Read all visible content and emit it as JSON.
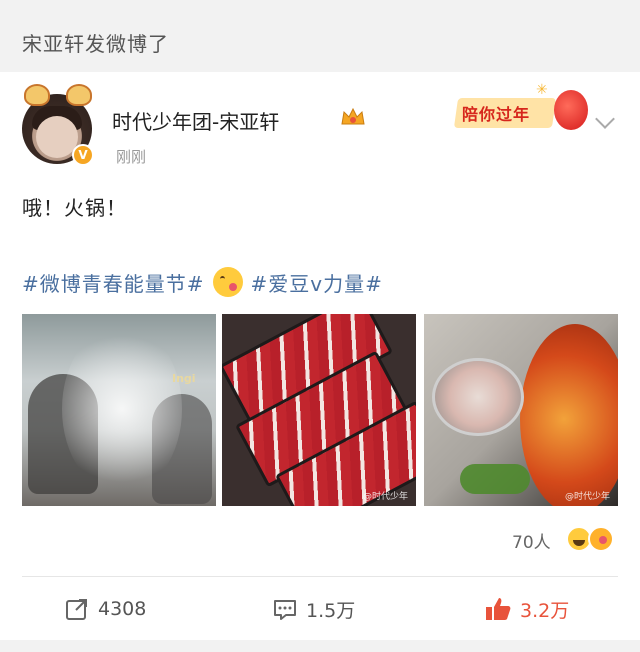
{
  "header": {
    "title": "宋亚轩发微博了"
  },
  "post": {
    "author": "时代少年团-宋亚轩",
    "time": "刚刚",
    "verified_badge": "V",
    "promo_label": "陪你过年",
    "text": "哦！火锅！",
    "topics": [
      "#微博青春能量节#",
      "#爱豆v力量#"
    ],
    "topic_color": "#4a6f9f",
    "images": [
      {
        "name": "steam-hotpot-photo",
        "watermark": ""
      },
      {
        "name": "beef-trays-photo",
        "watermark": "@时代少年"
      },
      {
        "name": "spicy-broth-photo",
        "watermark": "@时代少年"
      }
    ],
    "likes_people": "70人"
  },
  "actions": {
    "share_count": "4308",
    "comment_count": "1.5万",
    "like_count": "3.2万",
    "like_color": "#e8533b"
  }
}
